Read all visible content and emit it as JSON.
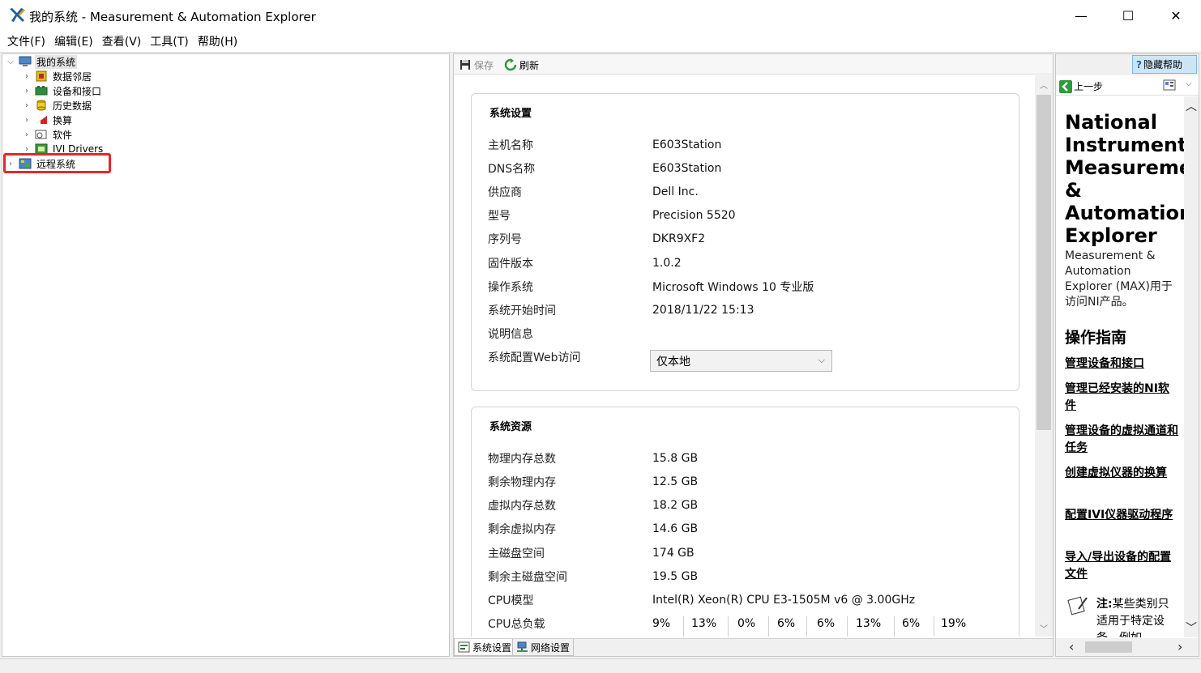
{
  "window": {
    "title": "我的系统 - Measurement & Automation Explorer",
    "minimize": "—",
    "maximize": "☐",
    "close": "✕"
  },
  "menu": [
    "文件(F)",
    "编辑(E)",
    "查看(V)",
    "工具(T)",
    "帮助(H)"
  ],
  "tree": {
    "root": "我的系统",
    "children": [
      "数据邻居",
      "设备和接口",
      "历史数据",
      "换算",
      "软件",
      "IVI Drivers"
    ],
    "remote": "远程系统"
  },
  "toolbar": {
    "save": "保存",
    "refresh": "刷新"
  },
  "settings": {
    "heading": "系统设置",
    "rows": [
      {
        "k": "主机名称",
        "v": "E603Station"
      },
      {
        "k": "DNS名称",
        "v": "E603Station"
      },
      {
        "k": "供应商",
        "v": "Dell Inc."
      },
      {
        "k": "型号",
        "v": "Precision 5520"
      },
      {
        "k": "序列号",
        "v": "DKR9XF2"
      },
      {
        "k": "固件版本",
        "v": "1.0.2"
      },
      {
        "k": "操作系统",
        "v": "Microsoft Windows 10 专业版"
      },
      {
        "k": "系统开始时间",
        "v": "2018/11/22 15:13"
      },
      {
        "k": "说明信息",
        "v": ""
      },
      {
        "k": "系统配置Web访问",
        "v": ""
      }
    ],
    "web_access_value": "仅本地"
  },
  "resources": {
    "heading": "系统资源",
    "rows": [
      {
        "k": "物理内存总数",
        "v": "15.8 GB"
      },
      {
        "k": "剩余物理内存",
        "v": "12.5 GB"
      },
      {
        "k": "虚拟内存总数",
        "v": "18.2 GB"
      },
      {
        "k": "剩余虚拟内存",
        "v": "14.6 GB"
      },
      {
        "k": "主磁盘空间",
        "v": "174 GB"
      },
      {
        "k": "剩余主磁盘空间",
        "v": "19.5 GB"
      },
      {
        "k": "CPU模型",
        "v": "Intel(R) Xeon(R) CPU E3-1505M v6 @ 3.00GHz"
      }
    ],
    "cpu_load_label": "CPU总负载",
    "cpu_load": [
      "9%",
      "13%",
      "0%",
      "6%",
      "6%",
      "13%",
      "6%",
      "19%"
    ]
  },
  "tabs": [
    "系统设置",
    "网络设置"
  ],
  "help": {
    "hide_help": "隐藏帮助",
    "back": "上一步",
    "title": "National\nInstruments\nMeasurement\n&\nAutomation\nExplorer",
    "description": "Measurement & Automation Explorer (MAX)用于访问NI产品。",
    "heading": "操作指南",
    "links": [
      "管理设备和接口",
      "管理已经安装的NI软件",
      "管理设备的虚拟通道和任务",
      "创建虚拟仪器的换算",
      "配置IVI仪器驱动程序",
      "导入/导出设备的配置文件"
    ],
    "note_label": "注:",
    "note_text": "某些类别只适用于特定设备。例如"
  },
  "colors": {
    "highlight": "#e8262a",
    "hide_help_bg": "#cde6f7"
  }
}
